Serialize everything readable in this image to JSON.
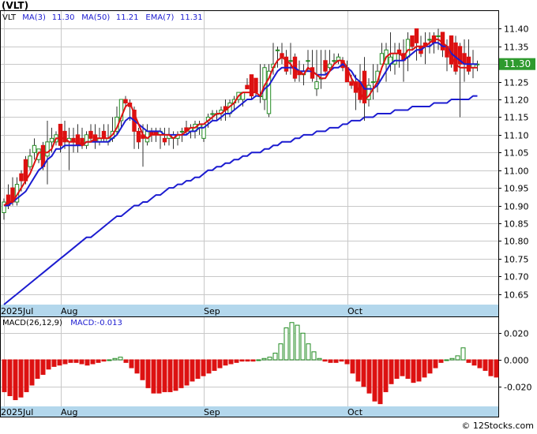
{
  "header": {
    "ticker_label": "(VLT)",
    "watermark": "© 12Stocks.com"
  },
  "price_legend": [
    {
      "text": "VLT",
      "color": "#000000"
    },
    {
      "text": "MA(3)",
      "color": "#1c1cd0"
    },
    {
      "text": "11.30",
      "color": "#1c1cd0"
    },
    {
      "text": "MA(50)",
      "color": "#1c1cd0"
    },
    {
      "text": "11.21",
      "color": "#1c1cd0"
    },
    {
      "text": "EMA(7)",
      "color": "#1c1cd0"
    },
    {
      "text": "11.31",
      "color": "#1c1cd0"
    }
  ],
  "macd_legend": [
    {
      "text": "MACD(26,12,9)",
      "color": "#000000"
    },
    {
      "text": "MACD:-0.013",
      "color": "#1c1cd0"
    }
  ],
  "last_price_badge": "11.30",
  "colors": {
    "up": "#228b22",
    "down": "#dd1111",
    "ma3": "#dd1111",
    "ma50": "#1c1cd0",
    "ema7": "#1c1cd0",
    "grid": "#c8c8c8",
    "axis_band": "#b3d7ec",
    "badge": "#2e9a2e"
  },
  "chart_data": [
    {
      "type": "candlestick",
      "title": "(VLT)",
      "x_labels": [
        {
          "label": "2025Jul",
          "index": 0
        },
        {
          "label": "Aug",
          "index": 13
        },
        {
          "label": "Sep",
          "index": 46
        },
        {
          "label": "Oct",
          "index": 79
        }
      ],
      "ylim": [
        10.62,
        11.45
      ],
      "yticks": [
        "10.65",
        "10.70",
        "10.75",
        "10.80",
        "10.85",
        "10.90",
        "10.95",
        "11.00",
        "11.05",
        "11.10",
        "11.15",
        "11.20",
        "11.25",
        "11.30",
        "11.35",
        "11.40"
      ],
      "grid": true,
      "ohlc": [
        [
          10.88,
          10.92,
          10.86,
          10.91
        ],
        [
          10.93,
          10.96,
          10.89,
          10.9
        ],
        [
          10.95,
          10.98,
          10.9,
          10.91
        ],
        [
          10.91,
          10.98,
          10.9,
          10.96
        ],
        [
          10.99,
          11.0,
          10.94,
          10.97
        ],
        [
          11.03,
          11.04,
          10.96,
          10.97
        ],
        [
          11.01,
          11.06,
          11.0,
          11.04
        ],
        [
          11.05,
          11.09,
          11.03,
          11.07
        ],
        [
          11.03,
          11.06,
          11.02,
          11.06
        ],
        [
          11.07,
          11.08,
          11.0,
          11.01
        ],
        [
          11.04,
          11.14,
          10.96,
          11.08
        ],
        [
          11.08,
          11.12,
          11.05,
          11.09
        ],
        [
          11.08,
          11.11,
          11.07,
          11.1
        ],
        [
          11.13,
          11.13,
          11.05,
          11.07
        ],
        [
          11.11,
          11.14,
          11.06,
          11.08
        ],
        [
          11.08,
          11.12,
          11.0,
          11.09
        ],
        [
          11.09,
          11.12,
          11.05,
          11.08
        ],
        [
          11.1,
          11.13,
          11.05,
          11.07
        ],
        [
          11.09,
          11.12,
          11.06,
          11.07
        ],
        [
          11.07,
          11.11,
          11.06,
          11.1
        ],
        [
          11.11,
          11.13,
          11.08,
          11.09
        ],
        [
          11.1,
          11.13,
          11.06,
          11.08
        ],
        [
          11.08,
          11.12,
          11.07,
          11.09
        ],
        [
          11.11,
          11.13,
          11.08,
          11.09
        ],
        [
          11.08,
          11.13,
          11.07,
          11.09
        ],
        [
          11.09,
          11.15,
          11.08,
          11.11
        ],
        [
          11.11,
          11.18,
          11.1,
          11.15
        ],
        [
          11.14,
          11.2,
          11.12,
          11.2
        ],
        [
          11.2,
          11.21,
          11.18,
          11.19
        ],
        [
          11.19,
          11.2,
          11.14,
          11.18
        ],
        [
          11.17,
          11.18,
          11.06,
          11.11
        ],
        [
          11.11,
          11.12,
          11.06,
          11.08
        ],
        [
          11.1,
          11.13,
          11.01,
          11.09
        ],
        [
          11.08,
          11.13,
          11.07,
          11.11
        ],
        [
          11.11,
          11.12,
          11.08,
          11.1
        ],
        [
          11.11,
          11.12,
          11.08,
          11.1
        ],
        [
          11.1,
          11.12,
          11.06,
          11.11
        ],
        [
          11.09,
          11.12,
          11.07,
          11.08
        ],
        [
          11.09,
          11.12,
          11.07,
          11.1
        ],
        [
          11.09,
          11.11,
          11.06,
          11.1
        ],
        [
          11.09,
          11.11,
          11.07,
          11.1
        ],
        [
          11.11,
          11.12,
          11.08,
          11.11
        ],
        [
          11.12,
          11.14,
          11.1,
          11.11
        ],
        [
          11.11,
          11.13,
          11.09,
          11.12
        ],
        [
          11.11,
          11.14,
          11.09,
          11.13
        ],
        [
          11.12,
          11.14,
          11.1,
          11.13
        ],
        [
          11.09,
          11.13,
          11.08,
          11.13
        ],
        [
          11.14,
          11.16,
          11.12,
          11.15
        ],
        [
          11.16,
          11.17,
          11.14,
          11.16
        ],
        [
          11.16,
          11.17,
          11.14,
          11.16
        ],
        [
          11.16,
          11.18,
          11.14,
          11.17
        ],
        [
          11.18,
          11.2,
          11.14,
          11.17
        ],
        [
          11.16,
          11.2,
          11.15,
          11.19
        ],
        [
          11.19,
          11.21,
          11.17,
          11.2
        ],
        [
          11.2,
          11.22,
          11.19,
          11.22
        ],
        [
          11.2,
          11.22,
          11.18,
          11.22
        ],
        [
          11.24,
          11.26,
          11.23,
          11.23
        ],
        [
          11.27,
          11.27,
          11.2,
          11.21
        ],
        [
          11.26,
          11.26,
          11.21,
          11.22
        ],
        [
          11.21,
          11.3,
          11.19,
          11.21
        ],
        [
          11.2,
          11.3,
          11.17,
          11.29
        ],
        [
          11.16,
          11.3,
          11.15,
          11.28
        ],
        [
          11.29,
          11.36,
          11.27,
          11.3
        ],
        [
          11.34,
          11.35,
          11.29,
          11.34
        ],
        [
          11.33,
          11.36,
          11.3,
          11.32
        ],
        [
          11.32,
          11.34,
          11.27,
          11.28
        ],
        [
          11.31,
          11.36,
          11.27,
          11.31
        ],
        [
          11.32,
          11.33,
          11.25,
          11.26
        ],
        [
          11.28,
          11.31,
          11.25,
          11.27
        ],
        [
          11.27,
          11.3,
          11.24,
          11.28
        ],
        [
          11.31,
          11.34,
          11.28,
          11.31
        ],
        [
          11.29,
          11.34,
          11.25,
          11.26
        ],
        [
          11.23,
          11.34,
          11.21,
          11.25
        ],
        [
          11.26,
          11.34,
          11.23,
          11.26
        ],
        [
          11.31,
          11.34,
          11.27,
          11.28
        ],
        [
          11.29,
          11.34,
          11.28,
          11.3
        ],
        [
          11.31,
          11.33,
          11.3,
          11.31
        ],
        [
          11.31,
          11.33,
          11.3,
          11.32
        ],
        [
          11.31,
          11.32,
          11.28,
          11.29
        ],
        [
          11.29,
          11.31,
          11.25,
          11.25
        ],
        [
          11.25,
          11.27,
          11.23,
          11.24
        ],
        [
          11.25,
          11.27,
          11.17,
          11.22
        ],
        [
          11.25,
          11.3,
          11.19,
          11.2
        ],
        [
          11.28,
          11.32,
          11.14,
          11.19
        ],
        [
          11.2,
          11.26,
          11.18,
          11.24
        ],
        [
          11.25,
          11.3,
          11.2,
          11.25
        ],
        [
          11.25,
          11.3,
          11.22,
          11.28
        ],
        [
          11.3,
          11.36,
          11.3,
          11.33
        ],
        [
          11.3,
          11.36,
          11.25,
          11.34
        ],
        [
          11.3,
          11.39,
          11.28,
          11.32
        ],
        [
          11.3,
          11.36,
          11.27,
          11.33
        ],
        [
          11.34,
          11.36,
          11.29,
          11.33
        ],
        [
          11.33,
          11.37,
          11.25,
          11.31
        ],
        [
          11.32,
          11.39,
          11.28,
          11.37
        ],
        [
          11.38,
          11.38,
          11.34,
          11.35
        ],
        [
          11.4,
          11.4,
          11.31,
          11.36
        ],
        [
          11.35,
          11.38,
          11.32,
          11.33
        ],
        [
          11.36,
          11.39,
          11.3,
          11.35
        ],
        [
          11.37,
          11.39,
          11.33,
          11.37
        ],
        [
          11.38,
          11.39,
          11.33,
          11.36
        ],
        [
          11.38,
          11.4,
          11.34,
          11.38
        ],
        [
          11.39,
          11.39,
          11.32,
          11.34
        ],
        [
          11.35,
          11.37,
          11.28,
          11.32
        ],
        [
          11.38,
          11.38,
          11.29,
          11.3
        ],
        [
          11.36,
          11.38,
          11.27,
          11.28
        ],
        [
          11.35,
          11.36,
          11.15,
          11.3
        ],
        [
          11.33,
          11.37,
          11.25,
          11.3
        ],
        [
          11.32,
          11.37,
          11.27,
          11.28
        ],
        [
          11.29,
          11.34,
          11.26,
          11.3
        ],
        [
          11.3,
          11.31,
          11.28,
          11.3
        ]
      ],
      "series": [
        {
          "name": "MA(3)",
          "values": [
            10.9,
            10.91,
            10.91,
            10.93,
            10.95,
            10.97,
            10.99,
            11.02,
            11.05,
            11.05,
            11.05,
            11.06,
            11.09,
            11.09,
            11.09,
            11.08,
            11.08,
            11.08,
            11.07,
            11.08,
            11.08,
            11.09,
            11.09,
            11.09,
            11.09,
            11.1,
            11.12,
            11.15,
            11.18,
            11.19,
            11.16,
            11.13,
            11.1,
            11.09,
            11.1,
            11.1,
            11.1,
            11.1,
            11.1,
            11.09,
            11.1,
            11.1,
            11.11,
            11.12,
            11.12,
            11.13,
            11.13,
            11.14,
            11.15,
            11.16,
            11.16,
            11.17,
            11.18,
            11.19,
            11.21,
            11.22,
            11.22,
            11.22,
            11.22,
            11.21,
            11.24,
            11.26,
            11.29,
            11.31,
            11.32,
            11.31,
            11.3,
            11.28,
            11.28,
            11.27,
            11.29,
            11.28,
            11.27,
            11.26,
            11.26,
            11.28,
            11.3,
            11.31,
            11.31,
            11.29,
            11.26,
            11.24,
            11.22,
            11.2,
            11.21,
            11.23,
            11.25,
            11.29,
            11.32,
            11.33,
            11.33,
            11.33,
            11.32,
            11.34,
            11.34,
            11.35,
            11.35,
            11.35,
            11.36,
            11.37,
            11.37,
            11.36,
            11.35,
            11.32,
            11.3,
            11.29,
            11.29,
            11.29,
            11.29,
            11.29
          ]
        },
        {
          "name": "EMA(7)",
          "values": [
            10.9,
            10.9,
            10.91,
            10.92,
            10.93,
            10.94,
            10.96,
            10.98,
            11.0,
            11.01,
            11.03,
            11.04,
            11.06,
            11.06,
            11.07,
            11.07,
            11.07,
            11.07,
            11.07,
            11.08,
            11.08,
            11.08,
            11.08,
            11.08,
            11.08,
            11.09,
            11.1,
            11.12,
            11.14,
            11.15,
            11.14,
            11.13,
            11.12,
            11.11,
            11.11,
            11.11,
            11.11,
            11.1,
            11.1,
            11.1,
            11.1,
            11.1,
            11.1,
            11.11,
            11.11,
            11.12,
            11.12,
            11.13,
            11.14,
            11.14,
            11.15,
            11.16,
            11.16,
            11.17,
            11.18,
            11.19,
            11.2,
            11.2,
            11.21,
            11.21,
            11.23,
            11.24,
            11.26,
            11.28,
            11.29,
            11.29,
            11.29,
            11.29,
            11.28,
            11.28,
            11.28,
            11.28,
            11.27,
            11.27,
            11.27,
            11.28,
            11.29,
            11.29,
            11.3,
            11.29,
            11.28,
            11.26,
            11.25,
            11.23,
            11.23,
            11.23,
            11.24,
            11.26,
            11.28,
            11.3,
            11.31,
            11.31,
            11.31,
            11.32,
            11.33,
            11.34,
            11.34,
            11.35,
            11.35,
            11.36,
            11.36,
            11.35,
            11.35,
            11.33,
            11.32,
            11.31,
            11.3,
            11.3,
            11.3,
            11.3
          ]
        },
        {
          "name": "MA(50)",
          "values": [
            10.62,
            10.63,
            10.64,
            10.65,
            10.66,
            10.67,
            10.68,
            10.69,
            10.7,
            10.71,
            10.72,
            10.73,
            10.74,
            10.75,
            10.76,
            10.77,
            10.78,
            10.79,
            10.8,
            10.81,
            10.81,
            10.82,
            10.83,
            10.84,
            10.85,
            10.86,
            10.87,
            10.87,
            10.88,
            10.89,
            10.9,
            10.9,
            10.91,
            10.91,
            10.92,
            10.93,
            10.93,
            10.94,
            10.95,
            10.95,
            10.96,
            10.96,
            10.97,
            10.97,
            10.98,
            10.98,
            10.99,
            11.0,
            11.0,
            11.01,
            11.01,
            11.02,
            11.02,
            11.03,
            11.03,
            11.04,
            11.04,
            11.05,
            11.05,
            11.05,
            11.06,
            11.06,
            11.07,
            11.07,
            11.08,
            11.08,
            11.08,
            11.09,
            11.09,
            11.1,
            11.1,
            11.1,
            11.11,
            11.11,
            11.11,
            11.12,
            11.12,
            11.12,
            11.13,
            11.13,
            11.14,
            11.14,
            11.14,
            11.15,
            11.15,
            11.15,
            11.16,
            11.16,
            11.16,
            11.16,
            11.17,
            11.17,
            11.17,
            11.17,
            11.18,
            11.18,
            11.18,
            11.18,
            11.18,
            11.19,
            11.19,
            11.19,
            11.19,
            11.2,
            11.2,
            11.2,
            11.2,
            11.2,
            11.21,
            11.21
          ]
        }
      ]
    },
    {
      "type": "bar",
      "title": "MACD(26,12,9)",
      "ylim": [
        -0.035,
        0.032
      ],
      "yticks": [
        "0.020",
        "0.000",
        "-0.020"
      ],
      "grid": true,
      "x_labels": [
        {
          "label": "2025Jul",
          "index": 0
        },
        {
          "label": "Aug",
          "index": 13
        },
        {
          "label": "Sep",
          "index": 46
        },
        {
          "label": "Oct",
          "index": 79
        }
      ],
      "values": [
        -0.024,
        -0.027,
        -0.03,
        -0.028,
        -0.024,
        -0.019,
        -0.014,
        -0.011,
        -0.007,
        -0.005,
        -0.004,
        -0.003,
        -0.002,
        -0.002,
        -0.003,
        -0.004,
        -0.003,
        -0.002,
        -0.001,
        0.0,
        0.001,
        0.002,
        -0.002,
        -0.006,
        -0.01,
        -0.015,
        -0.021,
        -0.025,
        -0.025,
        -0.024,
        -0.024,
        -0.023,
        -0.021,
        -0.019,
        -0.016,
        -0.014,
        -0.012,
        -0.01,
        -0.008,
        -0.006,
        -0.004,
        -0.003,
        -0.002,
        -0.001,
        -0.001,
        -0.001,
        0.0,
        0.001,
        0.002,
        0.005,
        0.012,
        0.024,
        0.028,
        0.026,
        0.02,
        0.012,
        0.006,
        0.001,
        -0.001,
        -0.002,
        -0.002,
        -0.001,
        -0.003,
        -0.01,
        -0.016,
        -0.02,
        -0.025,
        -0.031,
        -0.033,
        -0.024,
        -0.018,
        -0.014,
        -0.012,
        -0.014,
        -0.017,
        -0.016,
        -0.013,
        -0.01,
        -0.006,
        -0.002,
        0.0,
        0.001,
        0.003,
        0.009,
        -0.002,
        -0.004,
        -0.006,
        -0.008,
        -0.012,
        -0.013
      ]
    }
  ]
}
